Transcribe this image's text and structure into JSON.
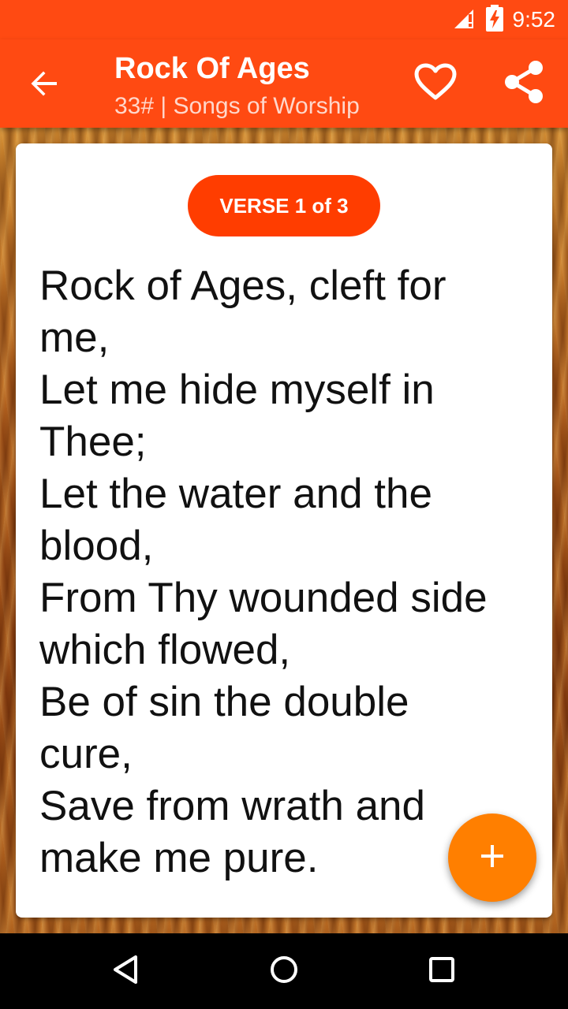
{
  "status_bar": {
    "time": "9:52",
    "icons": [
      "signal-icon",
      "battery-charging-icon"
    ]
  },
  "app_bar": {
    "title": "Rock Of Ages",
    "subtitle": "33# | Songs of Worship",
    "icons": [
      "back-arrow-icon",
      "heart-icon",
      "share-icon"
    ]
  },
  "card": {
    "verse_label": "VERSE 1 of 3",
    "lyrics": [
      "Rock of Ages, cleft for",
      "me,",
      "Let me hide myself in",
      "Thee;",
      "Let the water and the",
      "blood,",
      "From Thy wounded side",
      "which flowed,",
      "Be of sin the double",
      "cure,",
      "Save from wrath and",
      "make me pure."
    ]
  },
  "fab": {
    "icon": "plus-icon"
  },
  "nav_bar": {
    "icons": [
      "back-triangle-icon",
      "home-circle-icon",
      "recents-square-icon"
    ]
  },
  "colors": {
    "accent": "#ff4a12",
    "pill": "#ff3d00",
    "fab": "#ff7f00"
  }
}
